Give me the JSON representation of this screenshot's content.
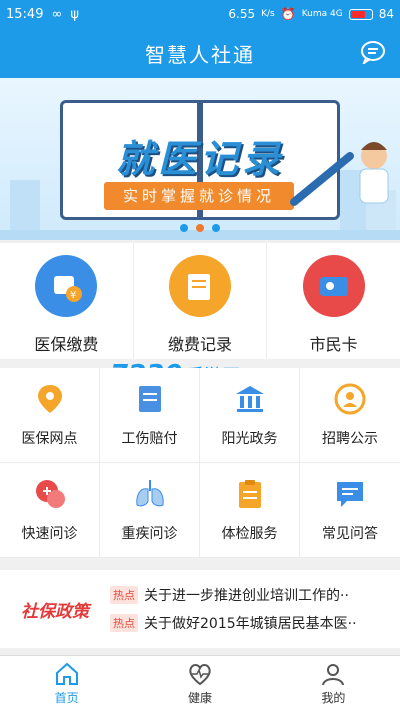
{
  "status": {
    "time": "15:49",
    "loop": "∞",
    "usb": "ψ",
    "speed": "6.55",
    "speed_unit": "K/s",
    "carriers": "Kuma 4G",
    "battery": "84"
  },
  "header": {
    "title": "智慧人社通"
  },
  "banner": {
    "title": "就医记录",
    "subtitle": "实时掌握就诊情况",
    "page_count": 3,
    "active_index": 1
  },
  "main": [
    {
      "label": "医保缴费",
      "icon": "medical-payment-icon",
      "color": "#3a8ee6"
    },
    {
      "label": "缴费记录",
      "icon": "payment-record-icon",
      "color": "#f4a52a"
    },
    {
      "label": "市民卡",
      "icon": "citizen-card-icon",
      "color": "#e84a4a"
    }
  ],
  "grid": [
    {
      "label": "医保网点",
      "icon": "location-pin-icon",
      "color": "#f4a52a"
    },
    {
      "label": "工伤赔付",
      "icon": "injury-compensation-icon",
      "color": "#4a90e2"
    },
    {
      "label": "阳光政务",
      "icon": "government-building-icon",
      "color": "#3a8ee6"
    },
    {
      "label": "招聘公示",
      "icon": "recruitment-icon",
      "color": "#f4a52a"
    },
    {
      "label": "快速问诊",
      "icon": "quick-consult-icon",
      "color": "#e84a4a"
    },
    {
      "label": "重疾问诊",
      "icon": "lungs-icon",
      "color": "#3a8ee6"
    },
    {
      "label": "体检服务",
      "icon": "checkup-clipboard-icon",
      "color": "#f4a52a"
    },
    {
      "label": "常见问答",
      "icon": "faq-chat-icon",
      "color": "#3a8ee6"
    }
  ],
  "watermark": {
    "number": "7230",
    "text": "手游网"
  },
  "news": {
    "logo": "社保政策",
    "items": [
      {
        "tag": "热点",
        "text": "关于进一步推进创业培训工作的··"
      },
      {
        "tag": "热点",
        "text": "关于做好2015年城镇居民基本医··"
      }
    ]
  },
  "tabs": [
    {
      "label": "首页",
      "icon": "home-icon",
      "active": true
    },
    {
      "label": "健康",
      "icon": "heart-pulse-icon",
      "active": false
    },
    {
      "label": "我的",
      "icon": "user-icon",
      "active": false
    }
  ],
  "colors": {
    "primary": "#1e9be8",
    "accent": "#f07a2a",
    "hot": "#e64a3a"
  }
}
